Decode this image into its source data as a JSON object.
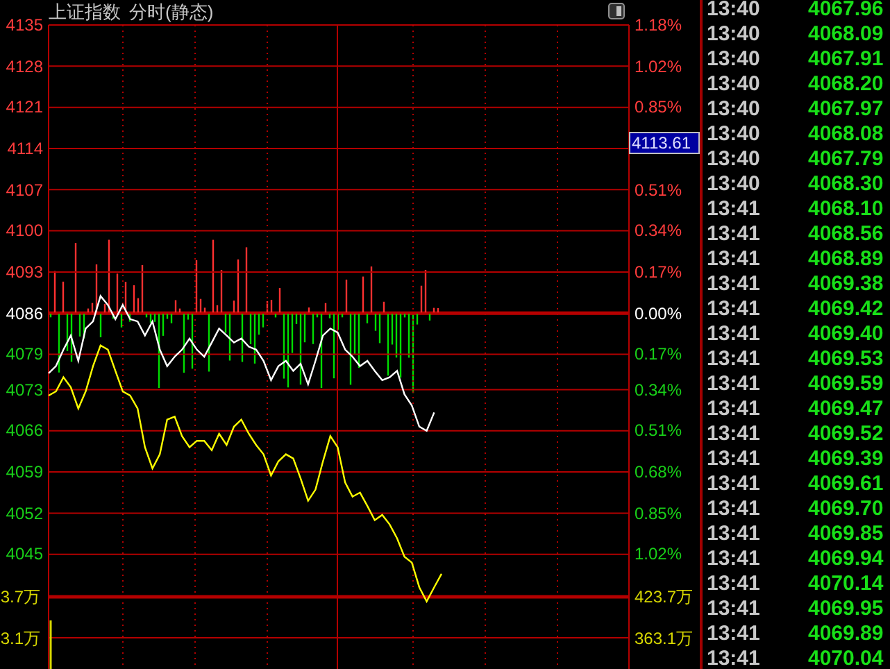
{
  "header": {
    "title": "上证指数",
    "mode": "分时(静态)"
  },
  "chart": {
    "chart_data": {
      "type": "line",
      "ylim": [
        4025.5,
        4135
      ],
      "grid": true,
      "yticks": [
        {
          "value": 4135,
          "label": "4135"
        },
        {
          "value": 4128,
          "label": "4128"
        },
        {
          "value": 4121,
          "label": "4121"
        },
        {
          "value": 4114,
          "label": "4114"
        },
        {
          "value": 4107,
          "label": "4107"
        },
        {
          "value": 4100,
          "label": "4100"
        },
        {
          "value": 4093,
          "label": "4093"
        },
        {
          "value": 4086,
          "label": "4086"
        },
        {
          "value": 4079,
          "label": "4079"
        },
        {
          "value": 4073,
          "label": "4073"
        },
        {
          "value": 4066,
          "label": "4066"
        },
        {
          "value": 4059,
          "label": "4059"
        },
        {
          "value": 4052,
          "label": "4052"
        },
        {
          "value": 4045,
          "label": "4045"
        }
      ],
      "series": [
        {
          "color": "#ffffff",
          "values": [
            4075.8,
            4077.0,
            4079.8,
            4082.2,
            4077.9,
            4083.4,
            4084.6,
            4088.9,
            4087.4,
            4085.0,
            4087.4,
            4085.0,
            4084.6,
            4082.2,
            4084.6,
            4079.8,
            4077.0,
            4078.6,
            4079.8,
            4081.7,
            4079.8,
            4078.6,
            4081.0,
            4083.4,
            4082.2,
            4081.0,
            4081.7,
            4080.3,
            4079.8,
            4077.9,
            4074.6,
            4077.0,
            4077.9,
            4076.2,
            4077.4,
            4073.9,
            4077.9,
            4082.2,
            4083.4,
            4082.7,
            4079.8,
            4078.6,
            4077.0,
            4077.9,
            4076.2,
            4074.6,
            4075.1,
            4076.2,
            4072.2,
            4070.3,
            4066.7,
            4066.0,
            4069.1,
            null
          ]
        },
        {
          "color": "#ffff00",
          "values": [
            4072.0,
            4072.7,
            4075.1,
            4073.4,
            4069.8,
            4072.7,
            4077.0,
            4080.5,
            4079.8,
            4076.2,
            4072.7,
            4072.0,
            4069.8,
            4063.2,
            4059.6,
            4062.0,
            4067.9,
            4068.4,
            4065.1,
            4063.2,
            4064.3,
            4064.3,
            4062.7,
            4065.5,
            4063.6,
            4066.7,
            4067.9,
            4065.5,
            4063.6,
            4062.0,
            4058.4,
            4060.8,
            4062.0,
            4061.3,
            4057.9,
            4054.1,
            4056.0,
            4060.8,
            4065.1,
            4063.2,
            4057.2,
            4054.8,
            4055.5,
            4053.2,
            4050.8,
            4051.7,
            4050.1,
            4047.7,
            4044.6,
            4043.6,
            4039.4,
            4037.0,
            4039.4,
            4041.7
          ]
        }
      ]
    },
    "right_axis": [
      {
        "text": "1.18%",
        "kind": "percent",
        "color": "#ff3c3c"
      },
      {
        "text": "1.02%",
        "kind": "percent",
        "color": "#ff3c3c"
      },
      {
        "text": "0.85%",
        "kind": "percent",
        "color": "#ff3c3c"
      },
      {
        "text": "4113.61",
        "kind": "cursor",
        "color": "#ff3c3c"
      },
      {
        "text": "0.51%",
        "kind": "percent",
        "color": "#ff3c3c"
      },
      {
        "text": "0.34%",
        "kind": "percent",
        "color": "#ff3c3c"
      },
      {
        "text": "0.17%",
        "kind": "percent",
        "color": "#ff3c3c"
      },
      {
        "text": "0.00%",
        "kind": "zero",
        "color": "#ffffff"
      },
      {
        "text": "0.17%",
        "kind": "percent",
        "color": "#18d018"
      },
      {
        "text": "0.34%",
        "kind": "percent",
        "color": "#18d018"
      },
      {
        "text": "0.51%",
        "kind": "percent",
        "color": "#18d018"
      },
      {
        "text": "0.68%",
        "kind": "percent",
        "color": "#18d018"
      },
      {
        "text": "0.85%",
        "kind": "percent",
        "color": "#18d018"
      },
      {
        "text": "1.02%",
        "kind": "percent",
        "color": "#18d018"
      }
    ],
    "volume_axis": [
      {
        "left": "3.7万",
        "right": "423.7万"
      },
      {
        "left": "3.1万",
        "right": "363.1万"
      }
    ]
  },
  "ticks": [
    {
      "time": "13:40",
      "price": "4067.96"
    },
    {
      "time": "13:40",
      "price": "4068.09"
    },
    {
      "time": "13:40",
      "price": "4067.91"
    },
    {
      "time": "13:40",
      "price": "4068.20"
    },
    {
      "time": "13:40",
      "price": "4067.97"
    },
    {
      "time": "13:40",
      "price": "4068.08"
    },
    {
      "time": "13:40",
      "price": "4067.79"
    },
    {
      "time": "13:40",
      "price": "4068.30"
    },
    {
      "time": "13:41",
      "price": "4068.10"
    },
    {
      "time": "13:41",
      "price": "4068.56"
    },
    {
      "time": "13:41",
      "price": "4068.89"
    },
    {
      "time": "13:41",
      "price": "4069.38"
    },
    {
      "time": "13:41",
      "price": "4069.42"
    },
    {
      "time": "13:41",
      "price": "4069.40"
    },
    {
      "time": "13:41",
      "price": "4069.53"
    },
    {
      "time": "13:41",
      "price": "4069.59"
    },
    {
      "time": "13:41",
      "price": "4069.47"
    },
    {
      "time": "13:41",
      "price": "4069.52"
    },
    {
      "time": "13:41",
      "price": "4069.39"
    },
    {
      "time": "13:41",
      "price": "4069.61"
    },
    {
      "time": "13:41",
      "price": "4069.70"
    },
    {
      "time": "13:41",
      "price": "4069.85"
    },
    {
      "time": "13:41",
      "price": "4069.94"
    },
    {
      "time": "13:41",
      "price": "4070.14"
    },
    {
      "time": "13:41",
      "price": "4069.95"
    },
    {
      "time": "13:41",
      "price": "4069.89"
    },
    {
      "time": "13:41",
      "price": "4070.04"
    }
  ]
}
